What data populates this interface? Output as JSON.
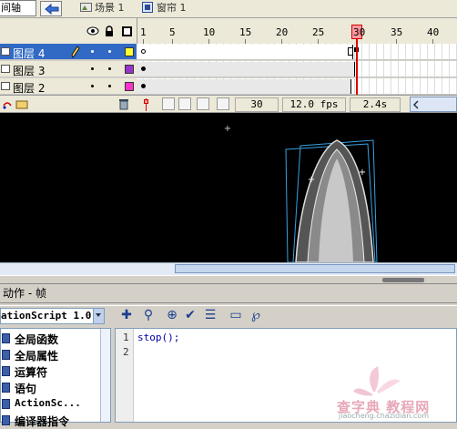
{
  "topbar": {
    "timeline_tab": "间轴",
    "scene_label": "场景 1",
    "symbol_label": "窗帘 1"
  },
  "timeline": {
    "frame_numbers": [
      "1",
      "5",
      "10",
      "15",
      "20",
      "25",
      "30",
      "35",
      "40"
    ],
    "layers": [
      {
        "name": "图层 4",
        "selected": true,
        "color": "#ffff33"
      },
      {
        "name": "图层 3",
        "selected": false,
        "color": "#9933cc"
      },
      {
        "name": "图层 2",
        "selected": false,
        "color": "#ff33cc"
      }
    ],
    "current_frame": "30",
    "fps": "12.0 fps",
    "elapsed": "2.4s"
  },
  "actions_panel": {
    "title": "动作 - 帧",
    "language": "ationScript 1.0",
    "tree_items": [
      "全局函数",
      "全局属性",
      "运算符",
      "语句",
      "ActionSc...",
      "编译器指令"
    ],
    "line_numbers": [
      "1",
      "2"
    ],
    "code": "stop();"
  },
  "watermark": {
    "text": "查字典 教程网",
    "url": "jiaocheng.chazidian.com"
  },
  "colors": {
    "selection": "#316ac5",
    "playhead": "#dd0000",
    "stage": "#000000",
    "panel_bg": "#d4d0c8"
  }
}
